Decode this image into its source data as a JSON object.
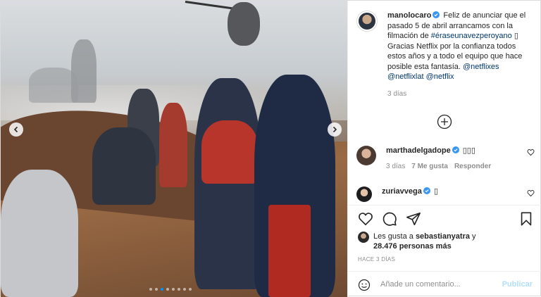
{
  "post": {
    "username": "manolocaro",
    "caption": "Feliz de anunciar que el pasado 5 de abril arrancamos con la filmación de ",
    "hashtag": "#éraseunavezperoyano",
    "caption_emoji": "▯",
    "caption_2": " Gracias Netflix por la confianza todos estos años y a todo el equipo que hace posible esta fantasía. ",
    "mention_1": "@netflixes",
    "mention_2": "@netflixlat",
    "mention_3": "@netflix",
    "time": "3 días"
  },
  "comments": [
    {
      "username": "marthadelgadope",
      "text": "▯▯▯",
      "time": "3 días",
      "likes": "7 Me gusta",
      "reply": "Responder"
    },
    {
      "username": "zuriavvega",
      "text": "▯"
    }
  ],
  "likes": {
    "prefix": "Les gusta a ",
    "user": "sebastianyatra",
    "suffix": " y",
    "count": "28.476 personas más"
  },
  "date_label": "HACE 3 DÍAS",
  "add_comment": {
    "placeholder": "Añade un comentario...",
    "publish": "Publicar"
  },
  "carousel": {
    "count": 8,
    "active": 2
  },
  "colors": {
    "verified": "#3897f0",
    "link": "#00376b",
    "publish_disabled": "#b2dffc",
    "active_dot": "#0095f6"
  },
  "icons": [
    "chevron-left-icon",
    "chevron-right-icon",
    "add-circle-icon",
    "heart-icon",
    "comment-icon",
    "share-icon",
    "bookmark-icon",
    "emoji-icon",
    "verified-icon"
  ]
}
